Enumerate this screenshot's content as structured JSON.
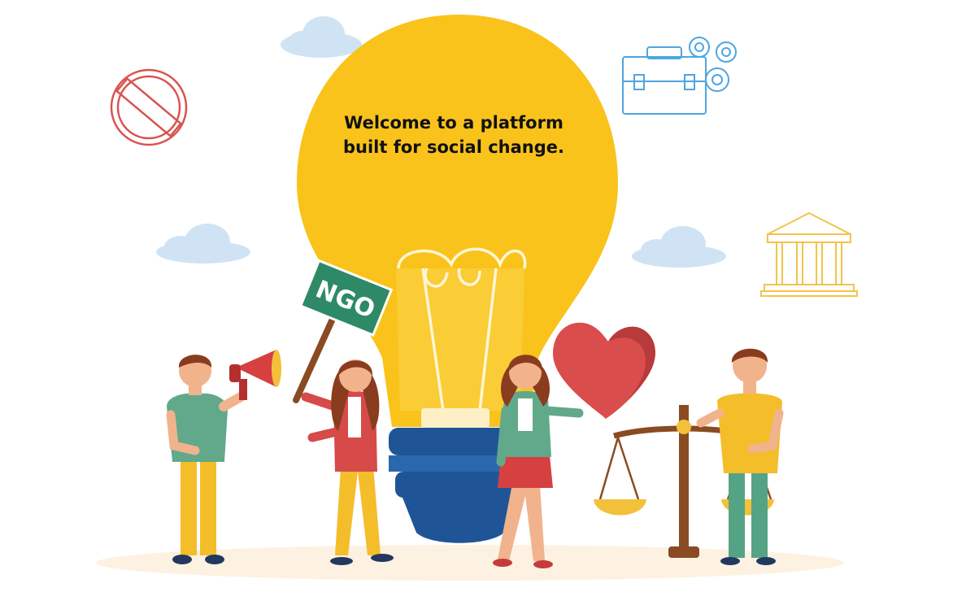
{
  "headline": {
    "line1": "Welcome to a platform",
    "line2": "built for social change."
  },
  "sign": {
    "label": "NGO"
  },
  "icons": [
    "no-entry-icon",
    "briefcase-gears-icon",
    "government-building-icon",
    "cloud-icon",
    "megaphone-icon",
    "heart-icon",
    "balance-scale-icon",
    "light-bulb-icon"
  ],
  "colors": {
    "bulb": "#f9c31b",
    "bulb_base": "#1f5597",
    "sign": "#2e8a66",
    "heart": "#d94d4d",
    "cloud": "#cfe3f5",
    "ground": "#fdf1e1"
  }
}
